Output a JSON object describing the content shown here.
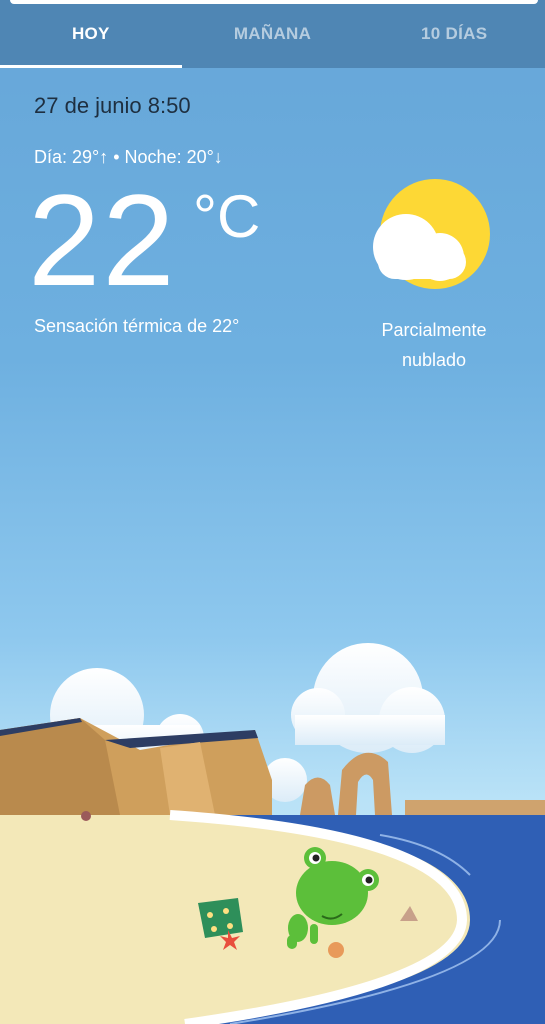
{
  "tabs": [
    {
      "label": "HOY",
      "active": true
    },
    {
      "label": "MAÑANA",
      "active": false
    },
    {
      "label": "10 DÍAS",
      "active": false
    }
  ],
  "current": {
    "datetime": "27 de junio 8:50",
    "day_night": "Día: 29°↑ • Noche: 20°↓",
    "temperature": "22",
    "unit": "°C",
    "feels_like": "Sensación térmica de 22°",
    "condition_line1": "Parcialmente",
    "condition_line2": "nublado",
    "icon": "partly-cloudy-icon"
  },
  "colors": {
    "header_bg": "#4f86b4",
    "sky_top": "#66a6d8",
    "sun": "#fdd835",
    "sea": "#2f5fb5",
    "sand": "#f3e8b8"
  }
}
